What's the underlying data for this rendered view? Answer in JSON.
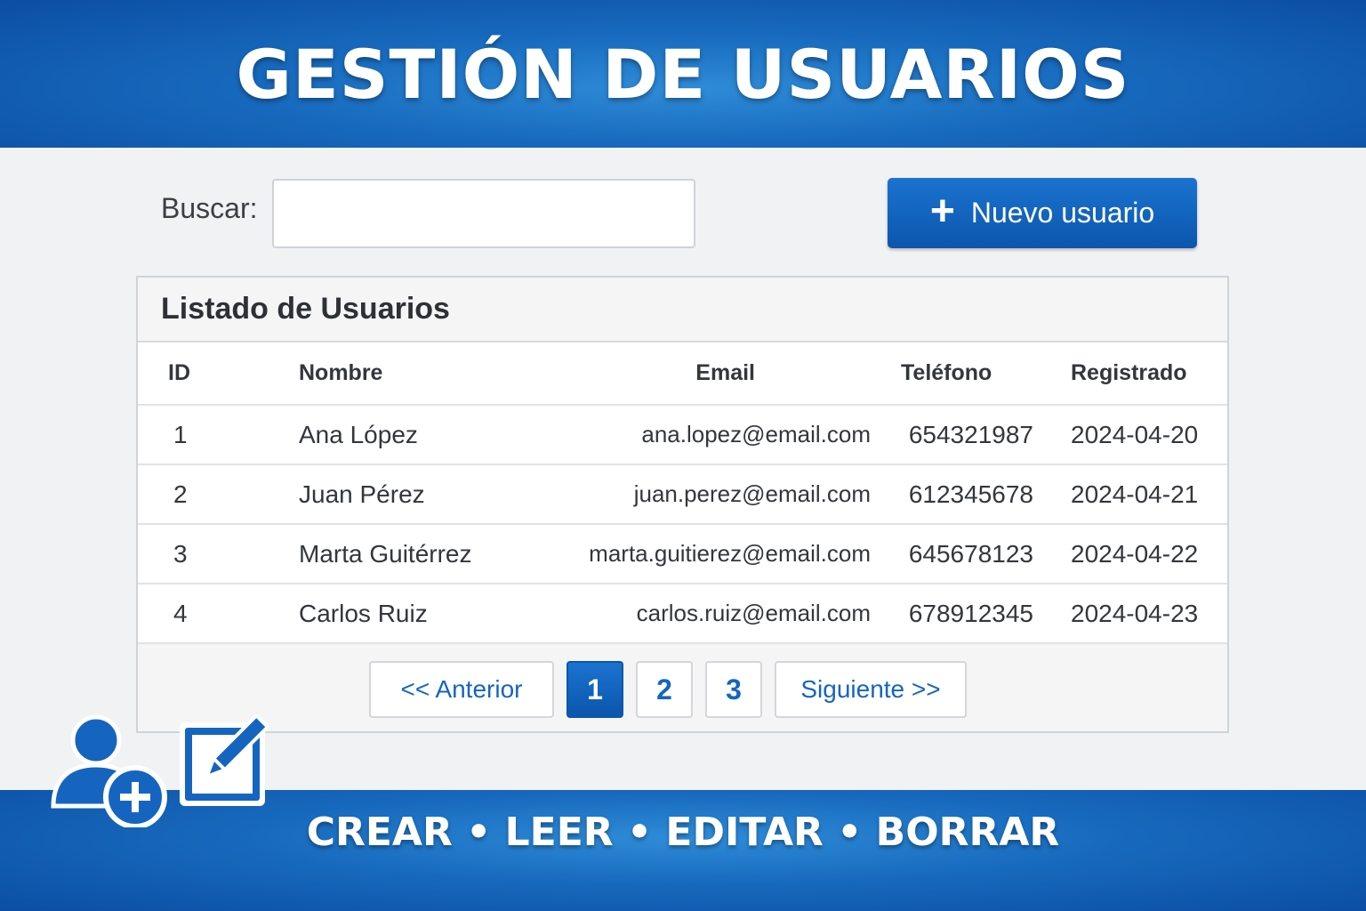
{
  "header": {
    "title": "GESTIÓN DE USUARIOS"
  },
  "toolbar": {
    "search_label": "Buscar:",
    "search_value": "",
    "new_user_label": "Nuevo usuario",
    "new_user_icon": "plus-icon"
  },
  "panel": {
    "title": "Listado de Usuarios",
    "columns": [
      "ID",
      "Nombre",
      "Email",
      "Teléfono",
      "Registrado"
    ],
    "rows": [
      {
        "id": "1",
        "name": "Ana López",
        "email": "ana.lopez@email.com",
        "phone": "654321987",
        "date": "2024-04-20"
      },
      {
        "id": "2",
        "name": "Juan Pérez",
        "email": "juan.perez@email.com",
        "phone": "612345678",
        "date": "2024-04-21"
      },
      {
        "id": "3",
        "name": "Marta Guitérrez",
        "email": "marta.guitierez@email.com",
        "phone": "645678123",
        "date": "2024-04-22"
      },
      {
        "id": "4",
        "name": "Carlos Ruiz",
        "email": "carlos.ruiz@email.com",
        "phone": "678912345",
        "date": "2024-04-23"
      }
    ]
  },
  "pagination": {
    "prev_label": "<<  Anterior",
    "pages": [
      "1",
      "2",
      "3"
    ],
    "active_page": "1",
    "next_label": "Siguiente  >>"
  },
  "footer": {
    "slogan": "CREAR • LEER • EDITAR • BORRAR"
  },
  "icons": {
    "add_user": "add-user-icon",
    "edit": "edit-icon"
  },
  "colors": {
    "primary": "#1565c0",
    "banner": "#1769bd",
    "background": "#f1f2f4"
  }
}
